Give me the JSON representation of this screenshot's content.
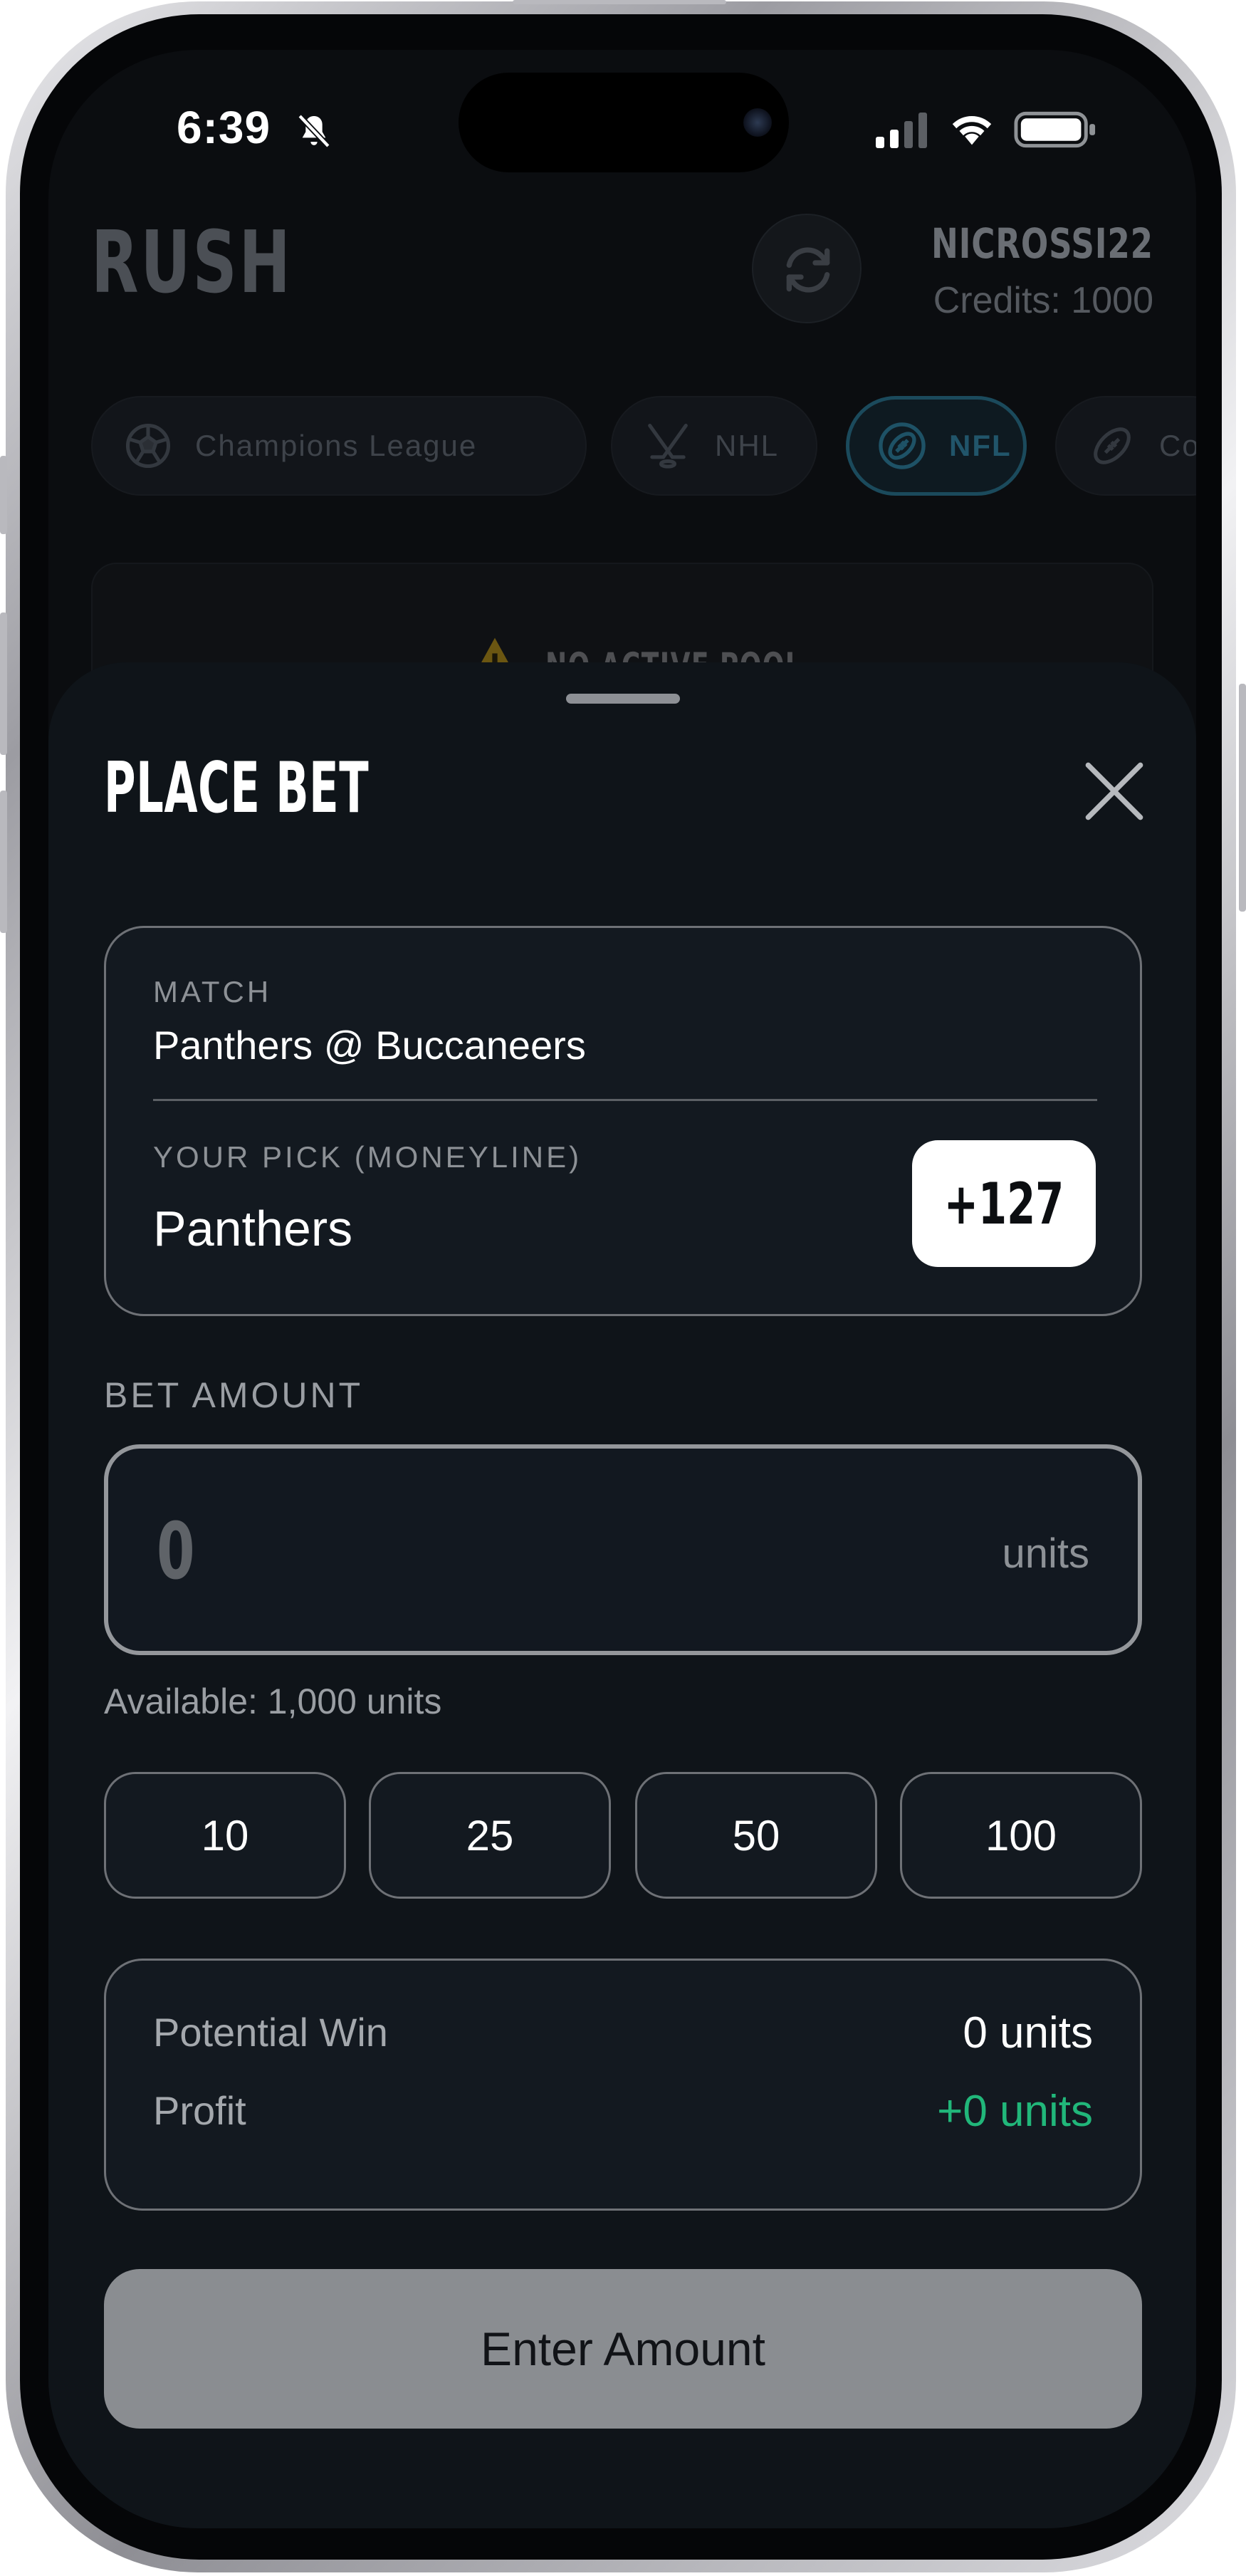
{
  "status_bar": {
    "time": "6:39",
    "icons": [
      "bell-slash-icon",
      "cellular-signal-icon",
      "wifi-icon",
      "battery-icon"
    ]
  },
  "app": {
    "logo": "RUSH",
    "username": "NICROSSI22",
    "credits": "Credits: 1000",
    "league_tabs": [
      {
        "label": "Champions League",
        "icon": "soccer-ball-icon",
        "active": false
      },
      {
        "label": "NHL",
        "icon": "hockey-sticks-icon",
        "active": false
      },
      {
        "label": "NFL",
        "icon": "football-icon",
        "active": true
      },
      {
        "label": "Colle",
        "icon": "football-icon",
        "active": false
      }
    ],
    "notice": "NO ACTIVE POOL"
  },
  "sheet": {
    "title": "PLACE BET",
    "match_label": "MATCH",
    "match_value": "Panthers @ Buccaneers",
    "pick_label": "YOUR PICK (MONEYLINE)",
    "pick_value": "Panthers",
    "odds": "+127",
    "bet_amount_label": "BET AMOUNT",
    "amount_value": "0",
    "amount_unit": "units",
    "available": "Available: 1,000 units",
    "quick_amounts": [
      "10",
      "25",
      "50",
      "100"
    ],
    "potential_win_label": "Potential Win",
    "potential_win_value": "0 units",
    "profit_label": "Profit",
    "profit_value": "+0 units",
    "submit_label": "Enter Amount"
  },
  "colors": {
    "background": "#0b0d10",
    "sheet": "#0f1419",
    "profit": "#21b77a",
    "active_tab": "#21556a",
    "warning": "#8a6d12"
  }
}
